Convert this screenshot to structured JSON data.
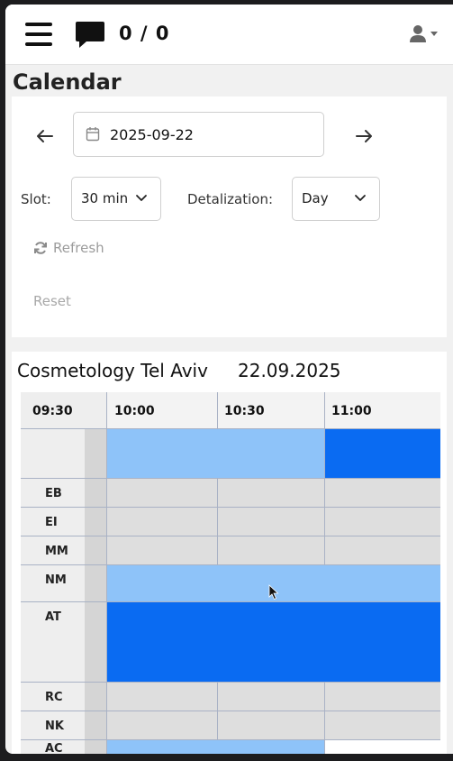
{
  "header": {
    "message_count": "0 / 0",
    "menu_icon": "hamburger-icon",
    "chat_icon": "chat-bubble-icon",
    "user_icon": "user-icon"
  },
  "page": {
    "title": "Calendar"
  },
  "controls": {
    "date_value": "2025-09-22",
    "slot_label": "Slot:",
    "slot_value": "30 min",
    "detalization_label": "Detalization:",
    "detalization_value": "Day",
    "refresh_label": "Refresh",
    "reset_label": "Reset"
  },
  "schedule": {
    "location": "Cosmetology Tel Aviv",
    "date": "22.09.2025",
    "corner_time": "09:30",
    "time_columns": [
      "10:00",
      "10:30",
      "11:00"
    ],
    "rows": [
      {
        "name": ""
      },
      {
        "name": "EB"
      },
      {
        "name": "EI"
      },
      {
        "name": "MM"
      },
      {
        "name": "NM"
      },
      {
        "name": "AT"
      },
      {
        "name": "RC"
      },
      {
        "name": "NK"
      },
      {
        "name": "AC"
      }
    ]
  },
  "colors": {
    "light_booking": "#8ec3f9",
    "dark_booking": "#0a6bf2",
    "empty_slot": "#dedede",
    "grid_line": "#a9b2c5"
  }
}
